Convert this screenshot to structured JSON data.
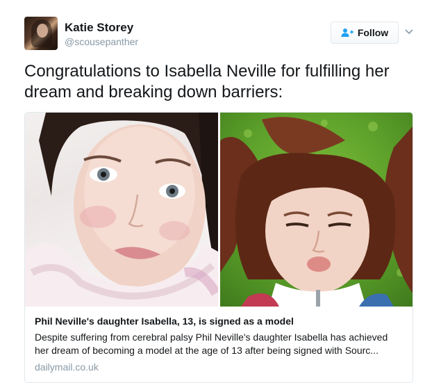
{
  "user": {
    "name": "Katie Storey",
    "handle": "@scousepanther"
  },
  "follow_button": {
    "label": "Follow",
    "icon": "follow-person-plus-icon"
  },
  "menu_icon": "chevron-down-icon",
  "tweet": {
    "text": "Congratulations to Isabella Neville for fulfilling her dream and breaking down barriers:"
  },
  "card": {
    "title": "Phil Neville's daughter Isabella, 13, is signed as a model",
    "description": "Despite suffering from cerebral palsy Phil Neville's daughter Isabella has achieved her dream of becoming a model at the age of 13 after being signed with Sourc...",
    "domain": "dailymail.co.uk"
  },
  "colors": {
    "text": "#14171a",
    "secondary": "#8899a6",
    "accent": "#1da1f2",
    "border": "#e1e8ed"
  }
}
